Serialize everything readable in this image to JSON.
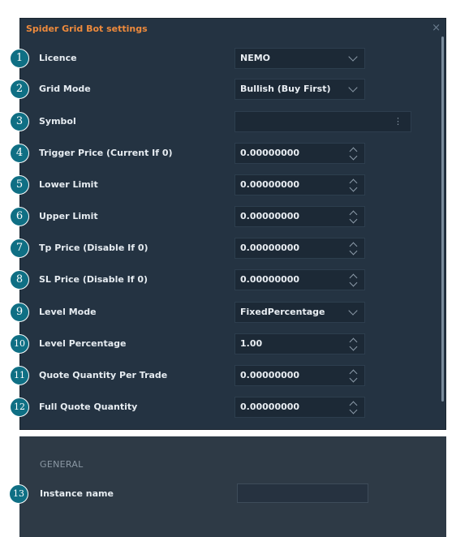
{
  "dialog": {
    "title": "Spider Grid Bot settings",
    "close_glyph": "×",
    "close_icon": "close-icon"
  },
  "fields": [
    {
      "badge": "1",
      "label": "Licence",
      "value": "NEMO",
      "control": "dropdown"
    },
    {
      "badge": "2",
      "label": "Grid Mode",
      "value": "Bullish (Buy First)",
      "control": "dropdown"
    },
    {
      "badge": "3",
      "label": "Symbol",
      "value": "",
      "control": "picker",
      "picker_glyph": "⋮"
    },
    {
      "badge": "4",
      "label": "Trigger Price (Current If 0)",
      "value": "0.00000000",
      "control": "spinner"
    },
    {
      "badge": "5",
      "label": "Lower Limit",
      "value": "0.00000000",
      "control": "spinner"
    },
    {
      "badge": "6",
      "label": "Upper Limit",
      "value": "0.00000000",
      "control": "spinner"
    },
    {
      "badge": "7",
      "label": "Tp Price (Disable If 0)",
      "value": "0.00000000",
      "control": "spinner"
    },
    {
      "badge": "8",
      "label": "SL Price (Disable If 0)",
      "value": "0.00000000",
      "control": "spinner"
    },
    {
      "badge": "9",
      "label": "Level Mode",
      "value": "FixedPercentage",
      "control": "dropdown"
    },
    {
      "badge": "10",
      "label": "Level Percentage",
      "value": "1.00",
      "control": "spinner"
    },
    {
      "badge": "11",
      "label": "Quote Quantity Per Trade",
      "value": "0.00000000",
      "control": "spinner"
    },
    {
      "badge": "12",
      "label": "Full Quote Quantity",
      "value": "0.00000000",
      "control": "spinner"
    }
  ],
  "general": {
    "section_title": "GENERAL",
    "instance_badge": "13",
    "instance_label": "Instance name",
    "instance_value": ""
  },
  "colors": {
    "panel": "#243342",
    "title_accent": "#ee8a3c",
    "badge": "#0f6f84"
  }
}
